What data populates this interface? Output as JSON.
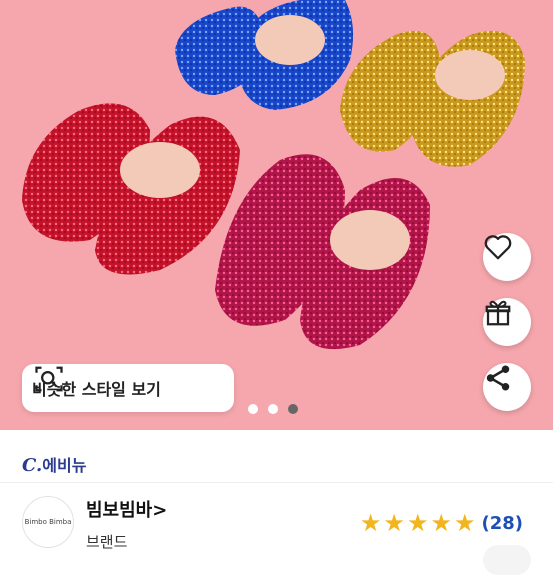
{
  "product": {
    "similar_style_label": "비슷한 스타일 보기",
    "carousel": {
      "total": 3,
      "active_index": 2
    }
  },
  "seller": {
    "logo_c": "C.",
    "name": "에비뉴"
  },
  "brand": {
    "logo_text": "Bimbo Bimba",
    "name": "빔보빔바>",
    "label": "브랜드"
  },
  "rating": {
    "stars": 5,
    "count": "(28)"
  },
  "icons": [
    "heart-icon",
    "gift-icon",
    "share-icon",
    "search-scan-icon",
    "star-icon"
  ],
  "colors": {
    "hero_bg": "#f6a7ad",
    "star": "#f2b51d",
    "seller": "#2b3b8f",
    "count": "#1e4fb3"
  }
}
